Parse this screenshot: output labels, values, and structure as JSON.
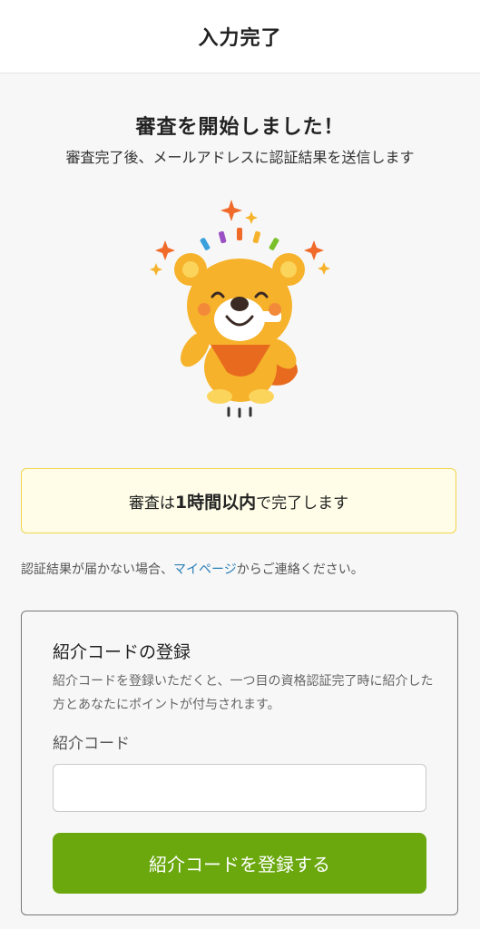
{
  "header": {
    "title": "入力完了"
  },
  "main": {
    "title": "審査を開始しました！",
    "subtitle": "審査完了後、メールアドレスに認証結果を送信します"
  },
  "notice": {
    "prefix": "審査は",
    "emphasis": "1時間以内",
    "suffix": "で完了します"
  },
  "contact": {
    "prefix": "認証結果が届かない場合、",
    "link": "マイページ",
    "suffix": "からご連絡ください。"
  },
  "referral": {
    "title": "紹介コードの登録",
    "description": "紹介コードを登録いただくと、一つ目の資格認証完了時に紹介した方とあなたにポイントが付与されます。",
    "field_label": "紹介コード",
    "input_value": "",
    "button_label": "紹介コードを登録する"
  },
  "colors": {
    "accent_green": "#6aa80e",
    "link_blue": "#2a7fb8",
    "notice_bg": "#fffde8",
    "notice_border": "#f1d64a",
    "mascot_orange": "#f6b22a"
  },
  "icons": {
    "mascot": "bear-mascot-celebrating-icon"
  }
}
